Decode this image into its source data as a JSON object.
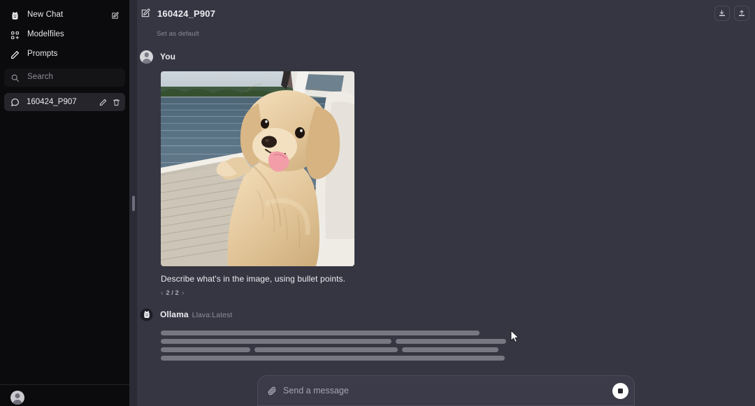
{
  "sidebar": {
    "nav_items": [
      {
        "label": "New Chat",
        "icon": "llama-icon",
        "trailing_icon": "compose-icon"
      },
      {
        "label": "Modelfiles",
        "icon": "modelfiles-icon",
        "trailing_icon": ""
      },
      {
        "label": "Prompts",
        "icon": "pencil-icon",
        "trailing_icon": ""
      }
    ],
    "search": {
      "placeholder": "Search",
      "icon": "search-icon",
      "value": ""
    },
    "chats": [
      {
        "title": "160424_P907",
        "icon": "chat-bubble-icon",
        "edit_icon": "pencil-icon",
        "delete_icon": "trash-icon",
        "selected": true
      }
    ]
  },
  "topbar": {
    "edit_icon": "compose-icon",
    "title": "160424_P907",
    "set_as_default": "Set as default",
    "download_icon": "download-icon",
    "upload_icon": "upload-icon"
  },
  "conversation": {
    "user_message": {
      "avatar": "user-avatar",
      "sender": "You",
      "image_alt": "golden-retriever-puppy-on-boat",
      "text": "Describe what's in the image, using bullet points.",
      "variant_prev": "‹",
      "variant_count": "2 / 2",
      "variant_next": "›"
    },
    "assistant_message": {
      "avatar": "ollama-avatar",
      "sender": "Ollama",
      "model": "Llava:Latest",
      "status": "loading",
      "skeleton_rows": [
        [
          456
        ],
        [
          330,
          158
        ],
        [
          128,
          205,
          138
        ],
        [
          492
        ]
      ]
    }
  },
  "composer": {
    "attach_icon": "paperclip-icon",
    "placeholder": "Send a message",
    "value": "",
    "stop_icon": "stop-square-icon"
  },
  "colors": {
    "sidebar_bg": "#0b0b0d",
    "main_bg": "#343541",
    "accent_text": "#ececf1",
    "muted_text": "#8f8f9a",
    "composer_bg": "#3b3b49",
    "selected_chat_bg": "#25252b"
  }
}
